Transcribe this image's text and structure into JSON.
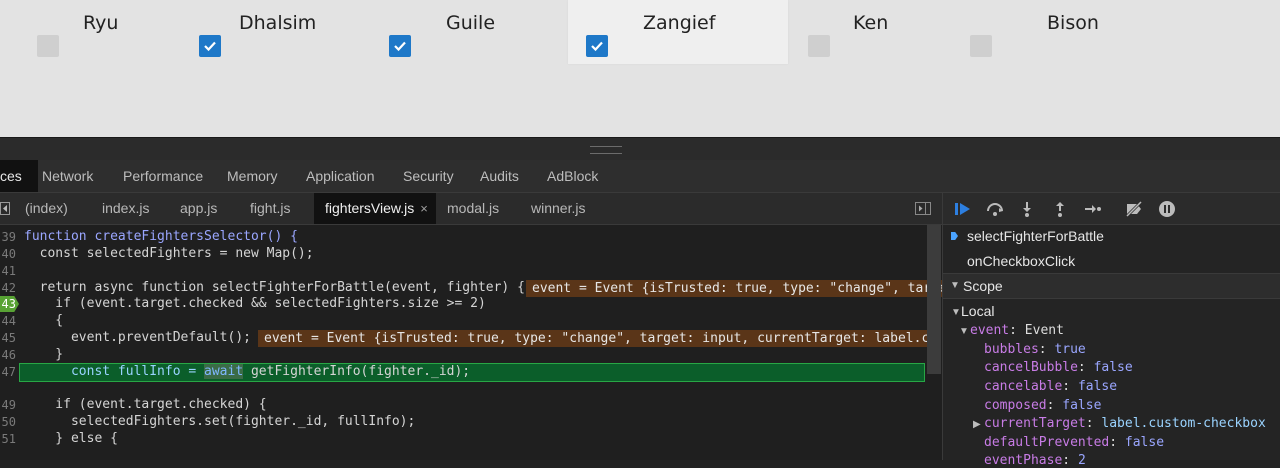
{
  "app": {
    "fighters": [
      {
        "name": "Ryu",
        "checked": false
      },
      {
        "name": "Dhalsim",
        "checked": true
      },
      {
        "name": "Guile",
        "checked": true
      },
      {
        "name": "Zangief",
        "checked": true
      },
      {
        "name": "Ken",
        "checked": false
      },
      {
        "name": "Bison",
        "checked": false
      }
    ]
  },
  "devtools": {
    "tabs": [
      "ces",
      "Network",
      "Performance",
      "Memory",
      "Application",
      "Security",
      "Audits",
      "AdBlock"
    ],
    "active_tab": "ces",
    "file_tabs": [
      "(index)",
      "index.js",
      "app.js",
      "fight.js",
      "fightersView.js",
      "modal.js",
      "winner.js"
    ],
    "active_file": "fightersView.js",
    "close_glyph": "×",
    "line_numbers": [
      "39",
      "40",
      "41",
      "42",
      "43",
      "44",
      "45",
      "46",
      "47",
      "",
      "49",
      "50",
      "51"
    ],
    "code": {
      "l39": "function createFightersSelector() {",
      "l40": "  const selectedFighters = new Map();",
      "l42": "  return async function selectFighterForBattle(event, fighter) {",
      "l43": "    if (event.target.checked && selectedFighters.size >= 2)",
      "l44": "    {",
      "l45": "      event.preventDefault();",
      "l46": "    }",
      "l47_pre": "      const fullInfo = ",
      "l47_await": "await",
      "l47_post": " getFighterInfo(fighter._id);",
      "l49": "    if (event.target.checked) {",
      "l50": "      selectedFighters.set(fighter._id, fullInfo);",
      "l51": "    } else {"
    },
    "inline_values": {
      "l42": "event = Event {isTrusted: true, type: \"change\", target: input",
      "l45": "event = Event {isTrusted: true, type: \"change\", target: input, currentTarget: label.custom"
    },
    "callstack": [
      "selectFighterForBattle",
      "onCheckboxClick"
    ],
    "scope": {
      "title": "Scope",
      "local": "Local",
      "event_key": "event",
      "event_type": "Event",
      "props": [
        {
          "key": "bubbles",
          "value": "true"
        },
        {
          "key": "cancelBubble",
          "value": "false"
        },
        {
          "key": "cancelable",
          "value": "false"
        },
        {
          "key": "composed",
          "value": "false"
        },
        {
          "key": "currentTarget",
          "value": "label.custom-checkbox"
        },
        {
          "key": "defaultPrevented",
          "value": "false"
        },
        {
          "key": "eventPhase",
          "value": "2"
        }
      ]
    }
  }
}
